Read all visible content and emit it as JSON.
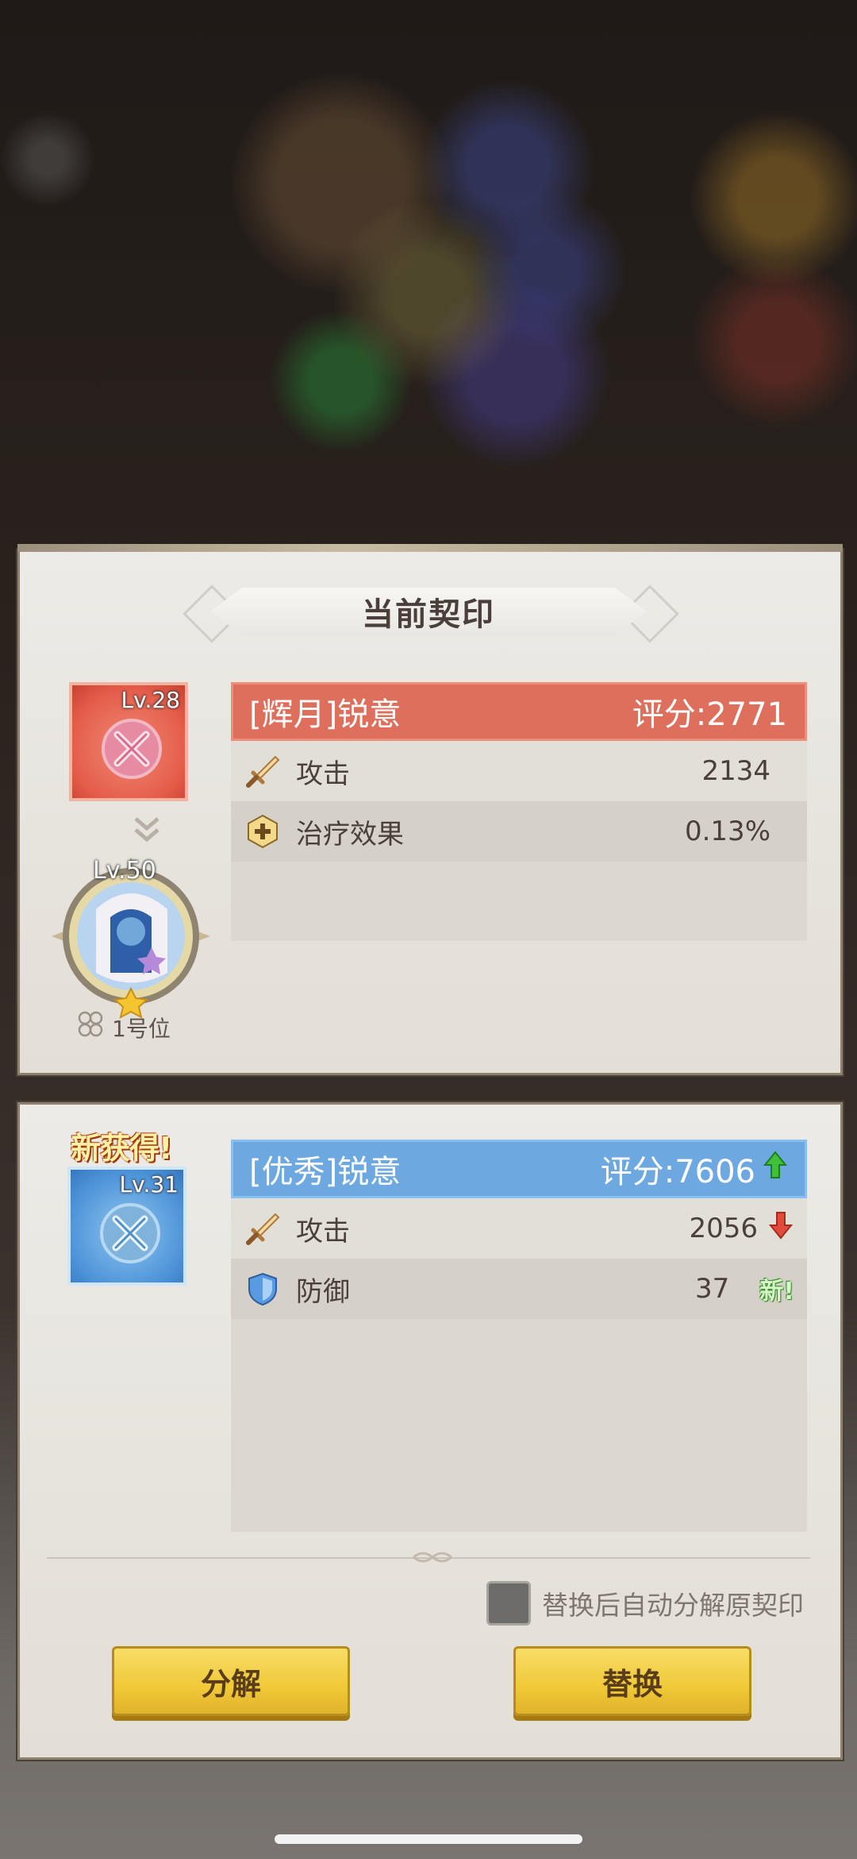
{
  "current_seal": {
    "title": "当前契印",
    "item": {
      "level": "Lv.28",
      "name": "[辉月]锐意",
      "score": "评分:2771"
    },
    "stats": [
      {
        "icon": "sword-icon",
        "name": "攻击",
        "value": "2134"
      },
      {
        "icon": "heal-icon",
        "name": "治疗效果",
        "value": "0.13%"
      }
    ],
    "character": {
      "level": "Lv.50",
      "slot": "1号位"
    }
  },
  "new_seal": {
    "badge": "新获得!",
    "item": {
      "level": "Lv.31",
      "name": "[优秀]锐意",
      "score": "评分:7606",
      "score_trend": "up"
    },
    "stats": [
      {
        "icon": "sword-icon",
        "name": "攻击",
        "value": "2056",
        "trend": "down"
      },
      {
        "icon": "shield-icon",
        "name": "防御",
        "value": "37",
        "tag": "新!"
      }
    ]
  },
  "auto_decompose": {
    "label": "替换后自动分解原契印",
    "checked": false
  },
  "buttons": {
    "decompose": "分解",
    "replace": "替换"
  },
  "colors": {
    "current_header": "#df6f5d",
    "new_header": "#6ea8e0",
    "button": "#f0c938",
    "up_arrow": "#3fbf3a",
    "down_arrow": "#e24b3b"
  }
}
